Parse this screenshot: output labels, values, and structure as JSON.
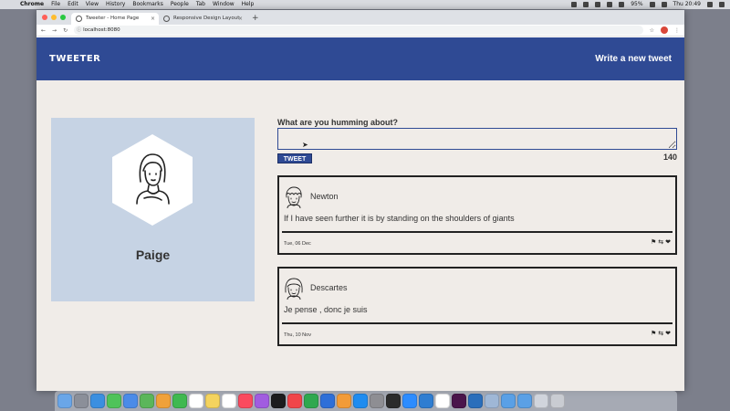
{
  "menubar": {
    "apple": "",
    "app_name": "Chrome",
    "menus": [
      "File",
      "Edit",
      "View",
      "History",
      "Bookmarks",
      "People",
      "Tab",
      "Window",
      "Help"
    ],
    "battery": "95%",
    "clock": "Thu 20:49"
  },
  "browser": {
    "tabs": [
      {
        "title": "Tweeter - Home Page",
        "active": true
      },
      {
        "title": "Responsive Design Layout",
        "active": false
      }
    ],
    "close_glyph": "×",
    "new_tab_glyph": "+",
    "url": "localhost:8080",
    "back_glyph": "←",
    "forward_glyph": "→",
    "reload_glyph": "↻",
    "star_glyph": "☆",
    "menu_glyph": "⋮",
    "info_glyph": "ⓘ"
  },
  "header": {
    "logo": "TWEETER",
    "write_link": "Write a new tweet"
  },
  "profile": {
    "name": "Paige"
  },
  "composer": {
    "label": "What are you humming about?",
    "value": "",
    "button_label": "TWEET",
    "counter": "140"
  },
  "tweets": [
    {
      "author": "Newton",
      "text": "If I have seen further it is by standing on the shoulders of giants",
      "date": "Tue, 06 Dec",
      "actions": [
        "⚑",
        "⇆",
        "❤"
      ]
    },
    {
      "author": "Descartes",
      "text": "Je pense , donc je suis",
      "date": "Thu, 10 Nov",
      "actions": [
        "⚑",
        "⇆",
        "❤"
      ]
    }
  ],
  "colors": {
    "brand": "#2f4a94",
    "page_bg": "#f0ece8",
    "profile_bg": "#c6d3e4"
  },
  "dock": {
    "apps": [
      "finder-icon",
      "launchpad-icon",
      "safari-icon",
      "messages-icon",
      "mail-icon",
      "maps-icon",
      "photos-icon",
      "facetime-icon",
      "calendar-icon",
      "notes-icon",
      "reminders-icon",
      "music-icon",
      "podcasts-icon",
      "tv-icon",
      "news-icon",
      "numbers-icon",
      "keynote-icon",
      "pages-icon",
      "app-store-icon",
      "system-preferences-icon",
      "terminal-icon",
      "zoom-icon",
      "vscode-icon",
      "chrome-icon",
      "slack-icon",
      "sourcetree-icon",
      "downloads-icon",
      "folder-icon",
      "folder-icon-2",
      "preview-icon",
      "trash-icon"
    ]
  }
}
